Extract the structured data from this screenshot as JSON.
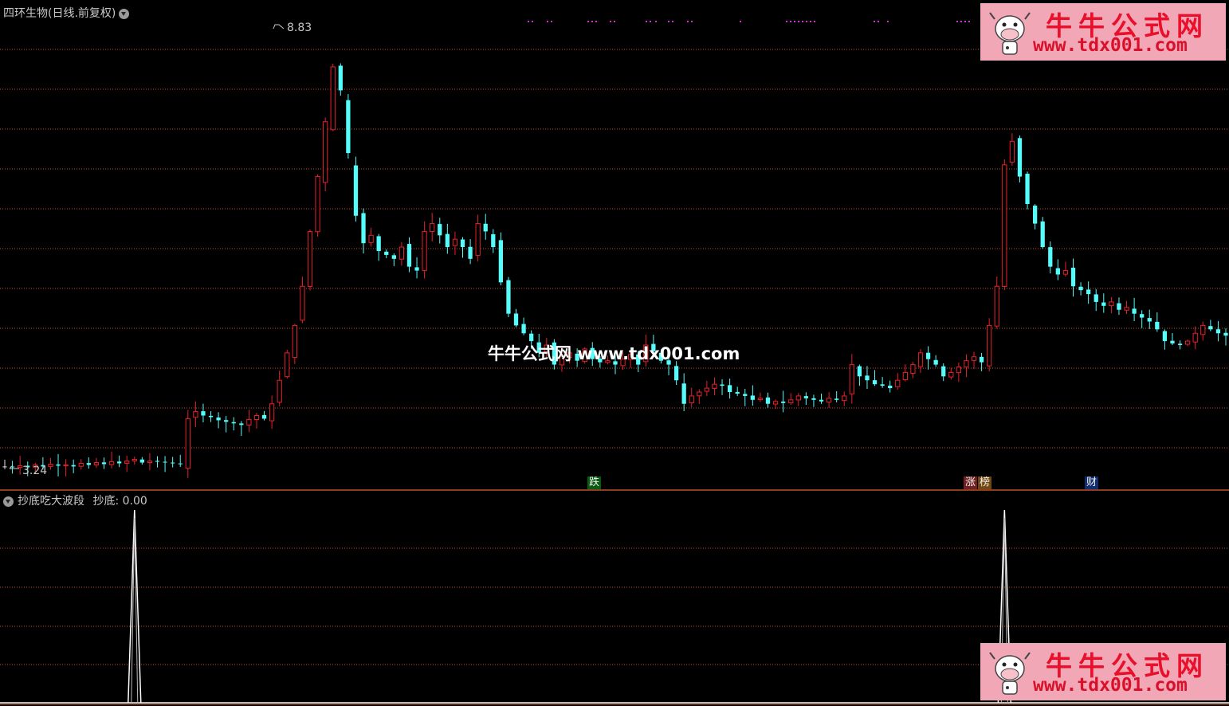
{
  "panel_main": {
    "title": "四环生物(日线.前复权)",
    "high_label": "8.83",
    "low_label": "3.24"
  },
  "panel_indicator": {
    "title": "抄底吃大波段",
    "value_label": "抄底: 0.00"
  },
  "event_tags": {
    "drop": "跌",
    "rise": "涨",
    "board": "榜",
    "finance": "财"
  },
  "watermark": {
    "brand": "牛牛公式网",
    "url": "www.tdx001.com",
    "center_text": "牛牛公式网 www.tdx001.com"
  },
  "colors": {
    "up": "#e8202a",
    "down": "#54fcfc",
    "flat": "#e0e0e0",
    "grid": "#c0502a",
    "indicator_line": "#ffffff"
  },
  "chart_data": [
    {
      "type": "candlestick",
      "title": "四环生物(日线.前复权)",
      "high_marker": 8.83,
      "low_marker": 3.24,
      "ylim": [
        3.0,
        9.0
      ],
      "close_series": [
        3.25,
        3.24,
        3.26,
        3.24,
        3.27,
        3.25,
        3.28,
        3.26,
        3.27,
        3.25,
        3.29,
        3.27,
        3.3,
        3.28,
        3.31,
        3.29,
        3.32,
        3.34,
        3.3,
        3.32,
        3.31,
        3.3,
        3.29,
        3.28,
        3.86,
        3.95,
        3.9,
        3.88,
        3.84,
        3.82,
        3.8,
        3.78,
        3.85,
        3.9,
        3.86,
        4.05,
        4.35,
        4.7,
        5.05,
        5.55,
        6.25,
        6.95,
        7.65,
        8.35,
        8.05,
        7.25,
        6.45,
        6.1,
        6.2,
        6.0,
        5.95,
        5.9,
        6.05,
        5.8,
        5.75,
        6.25,
        6.35,
        6.2,
        6.05,
        6.15,
        6.05,
        5.9,
        6.35,
        6.25,
        6.05,
        5.6,
        5.2,
        5.05,
        4.95,
        4.85,
        4.7,
        4.8,
        4.55,
        4.65,
        4.7,
        4.6,
        4.75,
        4.62,
        4.58,
        4.6,
        4.55,
        4.62,
        4.68,
        4.55,
        4.8,
        4.72,
        4.6,
        4.55,
        4.35,
        4.05,
        4.15,
        4.2,
        4.25,
        4.3,
        4.28,
        4.2,
        4.18,
        4.15,
        4.1,
        4.12,
        4.05,
        4.08,
        4.06,
        4.1,
        4.15,
        4.12,
        4.1,
        4.08,
        4.12,
        4.1,
        4.15,
        4.55,
        4.4,
        4.35,
        4.3,
        4.28,
        4.25,
        4.35,
        4.45,
        4.55,
        4.7,
        4.62,
        4.55,
        4.4,
        4.45,
        4.52,
        4.6,
        4.65,
        4.58,
        5.05,
        5.55,
        7.1,
        7.4,
        6.95,
        6.6,
        6.35,
        6.05,
        5.8,
        5.7,
        5.75,
        5.55,
        5.5,
        5.45,
        5.35,
        5.3,
        5.35,
        5.25,
        5.28,
        5.2,
        5.15,
        5.1,
        5.0,
        4.85,
        4.82,
        4.8,
        4.85,
        4.95,
        5.05,
        5.0,
        4.95,
        4.92
      ]
    },
    {
      "type": "line",
      "title": "抄底吃大波段",
      "series": [
        {
          "name": "抄底",
          "last_value": 0.0
        }
      ],
      "signals": [
        {
          "bar_index": 17,
          "value": 1
        },
        {
          "bar_index": 131,
          "value": 1
        }
      ],
      "ylim": [
        0,
        1
      ]
    }
  ]
}
